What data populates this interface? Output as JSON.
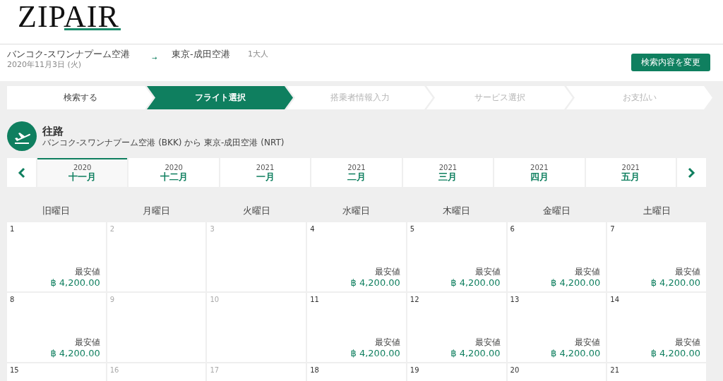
{
  "logo": "ZIPAIR",
  "search_summary": {
    "origin": "バンコク-スワンナプーム空港",
    "date": "2020年11月3日 (火)",
    "arrow": "→",
    "destination": "東京-成田空港",
    "passengers": "1大人",
    "change_button": "検索内容を変更"
  },
  "steps": [
    {
      "label": "検索する",
      "selected": false,
      "disabled": false
    },
    {
      "label": "フライト選択",
      "selected": true,
      "disabled": false
    },
    {
      "label": "搭乗者情報入力",
      "selected": false,
      "disabled": true
    },
    {
      "label": "サービス選択",
      "selected": false,
      "disabled": true
    },
    {
      "label": "お支払い",
      "selected": false,
      "disabled": true
    }
  ],
  "leg": {
    "title": "往路",
    "route": "バンコク-スワンナプーム空港 (BKK) から 東京-成田空港 (NRT)"
  },
  "months": [
    {
      "year": "2020",
      "month": "十一月",
      "selected": true
    },
    {
      "year": "2020",
      "month": "十二月",
      "selected": false
    },
    {
      "year": "2021",
      "month": "一月",
      "selected": false
    },
    {
      "year": "2021",
      "month": "二月",
      "selected": false
    },
    {
      "year": "2021",
      "month": "三月",
      "selected": false
    },
    {
      "year": "2021",
      "month": "四月",
      "selected": false
    },
    {
      "year": "2021",
      "month": "五月",
      "selected": false
    }
  ],
  "weekdays": [
    "旧曜日",
    "月曜日",
    "火曜日",
    "水曜日",
    "木曜日",
    "金曜日",
    "土曜日"
  ],
  "weeks": [
    [
      {
        "day": "1",
        "disabled": false,
        "label": "最安値",
        "price": "฿ 4,200.00"
      },
      {
        "day": "2",
        "disabled": true
      },
      {
        "day": "3",
        "disabled": true
      },
      {
        "day": "4",
        "disabled": false,
        "label": "最安値",
        "price": "฿ 4,200.00"
      },
      {
        "day": "5",
        "disabled": false,
        "label": "最安値",
        "price": "฿ 4,200.00"
      },
      {
        "day": "6",
        "disabled": false,
        "label": "最安値",
        "price": "฿ 4,200.00"
      },
      {
        "day": "7",
        "disabled": false,
        "label": "最安値",
        "price": "฿ 4,200.00"
      }
    ],
    [
      {
        "day": "8",
        "disabled": false,
        "label": "最安値",
        "price": "฿ 4,200.00"
      },
      {
        "day": "9",
        "disabled": true
      },
      {
        "day": "10",
        "disabled": true
      },
      {
        "day": "11",
        "disabled": false,
        "label": "最安値",
        "price": "฿ 4,200.00"
      },
      {
        "day": "12",
        "disabled": false,
        "label": "最安値",
        "price": "฿ 4,200.00"
      },
      {
        "day": "13",
        "disabled": false,
        "label": "最安値",
        "price": "฿ 4,200.00"
      },
      {
        "day": "14",
        "disabled": false,
        "label": "最安値",
        "price": "฿ 4,200.00"
      }
    ],
    [
      {
        "day": "15",
        "disabled": false
      },
      {
        "day": "16",
        "disabled": true
      },
      {
        "day": "17",
        "disabled": true
      },
      {
        "day": "18",
        "disabled": false
      },
      {
        "day": "19",
        "disabled": false
      },
      {
        "day": "20",
        "disabled": false
      },
      {
        "day": "21",
        "disabled": false
      }
    ]
  ]
}
